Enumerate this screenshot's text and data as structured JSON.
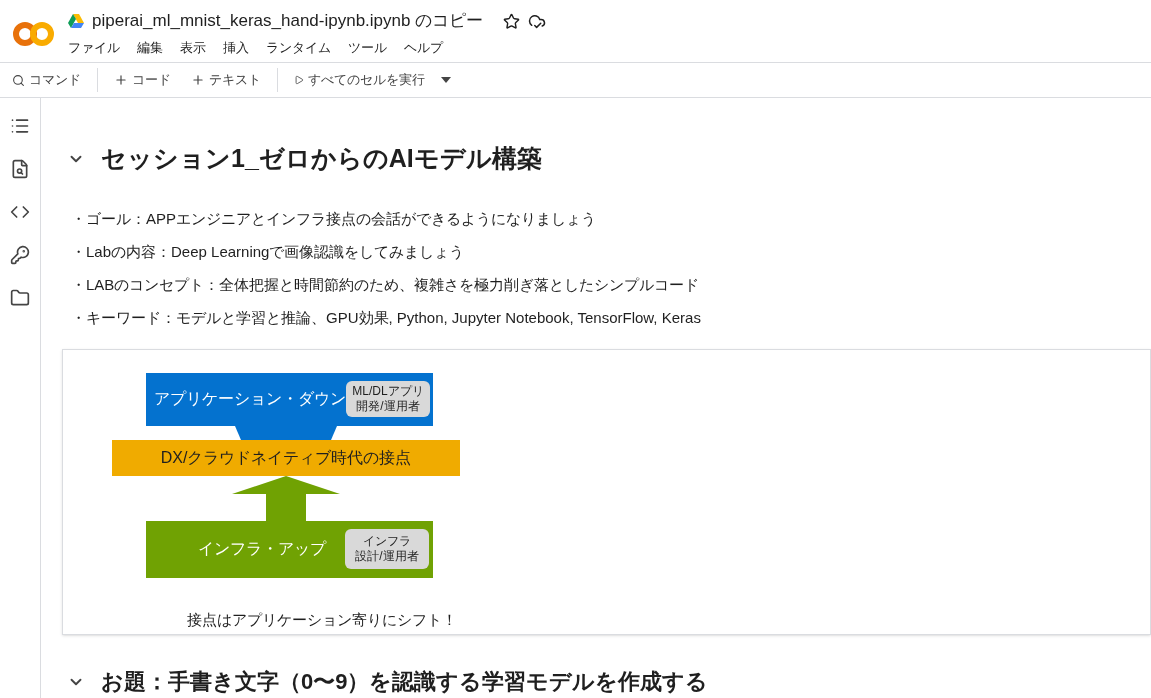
{
  "header": {
    "title": "piperai_ml_mnist_keras_hand-ipynb.ipynb のコピー",
    "menu": [
      "ファイル",
      "編集",
      "表示",
      "挿入",
      "ランタイム",
      "ツール",
      "ヘルプ"
    ]
  },
  "toolbar": {
    "command": "コマンド",
    "add_code": "コード",
    "add_text": "テキスト",
    "run_all": "すべてのセルを実行"
  },
  "sections": [
    {
      "heading": "セッション1_ゼロからのAIモデル構築",
      "expanded": true,
      "bullets": [
        "・ゴール：APPエンジニアとインフラ接点の会話ができるようになりましょう",
        "・Labの内容：Deep Learningで画像認識をしてみましょう",
        "・LABのコンセプト：全体把握と時間節約のため、複雑さを極力削ぎ落としたシンプルコード",
        "・キーワード：モデルと学習と推論、GPU効果, Python, Jupyter Notebook, TensorFlow, Keras"
      ],
      "diagram": {
        "top_box": "アプリケーション・ダウン",
        "top_badge": [
          "ML/DLアプリ",
          "開発/運用者"
        ],
        "middle_bar": "DX/クラウドネイティブ時代の接点",
        "bottom_box": "インフラ・アップ",
        "bottom_badge": [
          "インフラ",
          "設計/運用者"
        ],
        "caption": "接点はアプリケーション寄りにシフト！"
      }
    },
    {
      "heading": "お題：手書き文字（0〜9）を認識する学習モデルを作成する",
      "expanded": true
    }
  ]
}
